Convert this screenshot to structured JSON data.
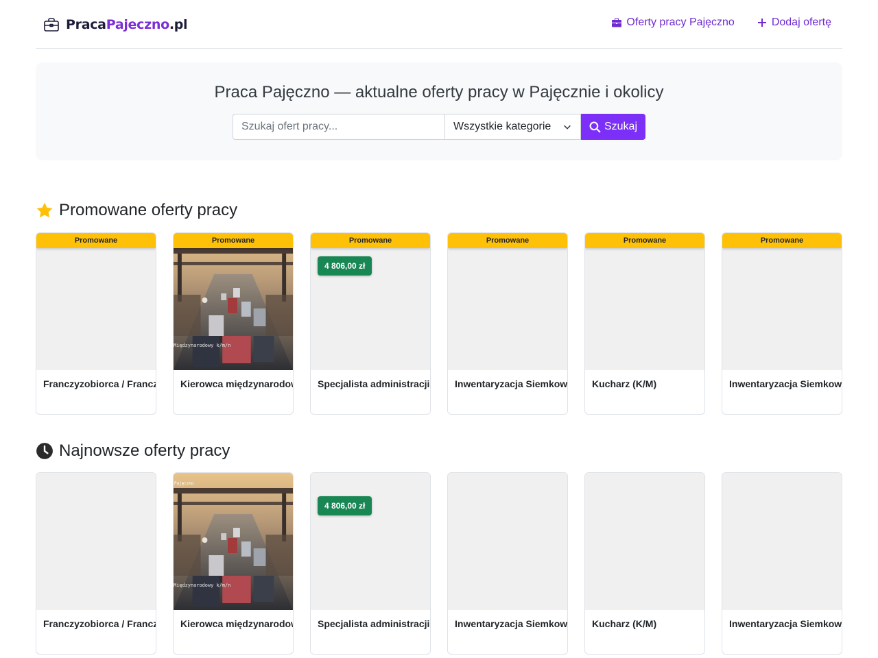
{
  "header": {
    "logo_part1": "Praca",
    "logo_part2": "Pajeczno",
    "logo_part3": ".pl",
    "nav": [
      {
        "label": "Oferty pracy Pajęczno",
        "icon": "briefcase-icon"
      },
      {
        "label": "Dodaj ofertę",
        "icon": "plus-icon"
      }
    ]
  },
  "hero": {
    "title": "Praca Pajęczno — aktualne oferty pracy w Pajęcznie i okolicy",
    "search_placeholder": "Szukaj ofert pracy...",
    "category_selected": "Wszystkie kategorie",
    "search_button": "Szukaj"
  },
  "promoted": {
    "title": "Promowane oferty pracy",
    "badge_label": "Promowane",
    "cards": [
      {
        "title": "Franczyzobiorca / Franczyzobiorczyni",
        "price": "",
        "image": "none"
      },
      {
        "title": "Kierowca międzynarodowy K/M/N",
        "price": "",
        "image": "trucks",
        "image_caption": "Międzynarodowy k/m/n"
      },
      {
        "title": "Specjalista administracji",
        "price": "4 806,00 zł",
        "image": "none"
      },
      {
        "title": "Inwentaryzacja Siemkowice",
        "price": "",
        "image": "none"
      },
      {
        "title": "Kucharz (K/M)",
        "price": "",
        "image": "none"
      },
      {
        "title": "Inwentaryzacja Siemkowice",
        "price": "",
        "image": "none"
      }
    ]
  },
  "latest": {
    "title": "Najnowsze oferty pracy",
    "cards": [
      {
        "title": "Franczyzobiorca / Franczyzobiorczyni",
        "price": "",
        "image": "none"
      },
      {
        "title": "Kierowca międzynarodowy K/M/N",
        "price": "",
        "image": "trucks",
        "image_caption": "Międzynarodowy k/m/n",
        "image_corner": "Pajęczno"
      },
      {
        "title": "Specjalista administracji",
        "price": "4 806,00 zł",
        "image": "none"
      },
      {
        "title": "Inwentaryzacja Siemkowice",
        "price": "",
        "image": "none"
      },
      {
        "title": "Kucharz (K/M)",
        "price": "",
        "image": "none"
      },
      {
        "title": "Inwentaryzacja Siemkowice",
        "price": "",
        "image": "none"
      }
    ]
  },
  "colors": {
    "accent": "#7b2ff7",
    "promo": "#ffc107",
    "price": "#198754"
  }
}
